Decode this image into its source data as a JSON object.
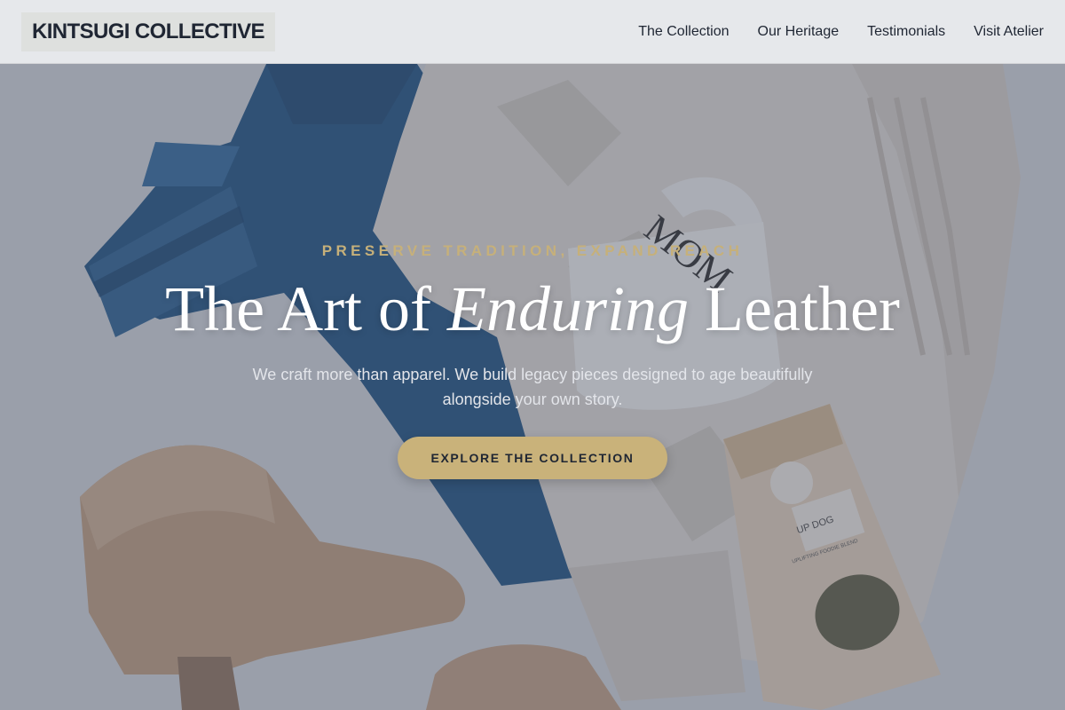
{
  "header": {
    "logo_text": "KINTSUGI COLLECTIVE",
    "nav": [
      {
        "label": "The Collection"
      },
      {
        "label": "Our Heritage"
      },
      {
        "label": "Testimonials"
      },
      {
        "label": "Visit Atelier"
      }
    ]
  },
  "hero": {
    "eyebrow": "PRESERVE TRADITION, EXPAND REACH",
    "headline_before": "The Art of ",
    "headline_em": "Enduring",
    "headline_after": " Leather",
    "subhead": "We craft more than apparel. We build legacy pieces designed to age beautifully alongside your own story.",
    "cta_label": "EXPLORE THE COLLECTION",
    "mug_text": "MOM",
    "tea_label": "UP DOG",
    "tea_sub": "UPLIFTING FOODIE BLEND"
  },
  "colors": {
    "accent_gold": "#c9b27a",
    "eyebrow_gold": "#c6b07a",
    "text_dark": "#1f2633",
    "header_bg": "#eceef0"
  }
}
